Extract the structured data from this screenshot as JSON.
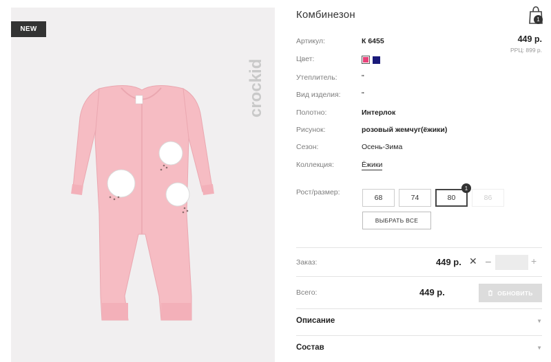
{
  "image": {
    "badge": "NEW",
    "brand": "crockid"
  },
  "product": {
    "title": "Комбинезон",
    "price": "449 р.",
    "rrp": "РРЦ: 899 р."
  },
  "cart": {
    "count": "1"
  },
  "attributes": [
    {
      "label": "Артикул:",
      "value": "К 6455"
    },
    {
      "label": "Цвет:",
      "value": ""
    },
    {
      "label": "Утеплитель:",
      "value": "\""
    },
    {
      "label": "Вид изделия:",
      "value": "\""
    },
    {
      "label": "Полотно:",
      "value": "Интерлок"
    },
    {
      "label": "Рисунок:",
      "value": "розовый жемчуг(ёжики)"
    },
    {
      "label": "Сезон:",
      "value": "Осень-Зима"
    },
    {
      "label": "Коллекция:",
      "value": "Ёжики"
    }
  ],
  "colors": [
    "#e8427a",
    "#1a1a7a"
  ],
  "sizes": {
    "label": "Рост/размер:",
    "options": [
      "68",
      "74",
      "80",
      "86"
    ],
    "selected": "80",
    "selected_count": "1",
    "select_all": "ВЫБРАТЬ ВСЕ"
  },
  "order": {
    "label": "Заказ:",
    "price": "449 р.",
    "remove": "✕",
    "minus": "–",
    "qty": "",
    "plus": "+"
  },
  "total": {
    "label": "Всего:",
    "price": "449 р.",
    "update": "ОБНОВИТЬ"
  },
  "accordions": [
    {
      "label": "Описание"
    },
    {
      "label": "Состав"
    }
  ]
}
